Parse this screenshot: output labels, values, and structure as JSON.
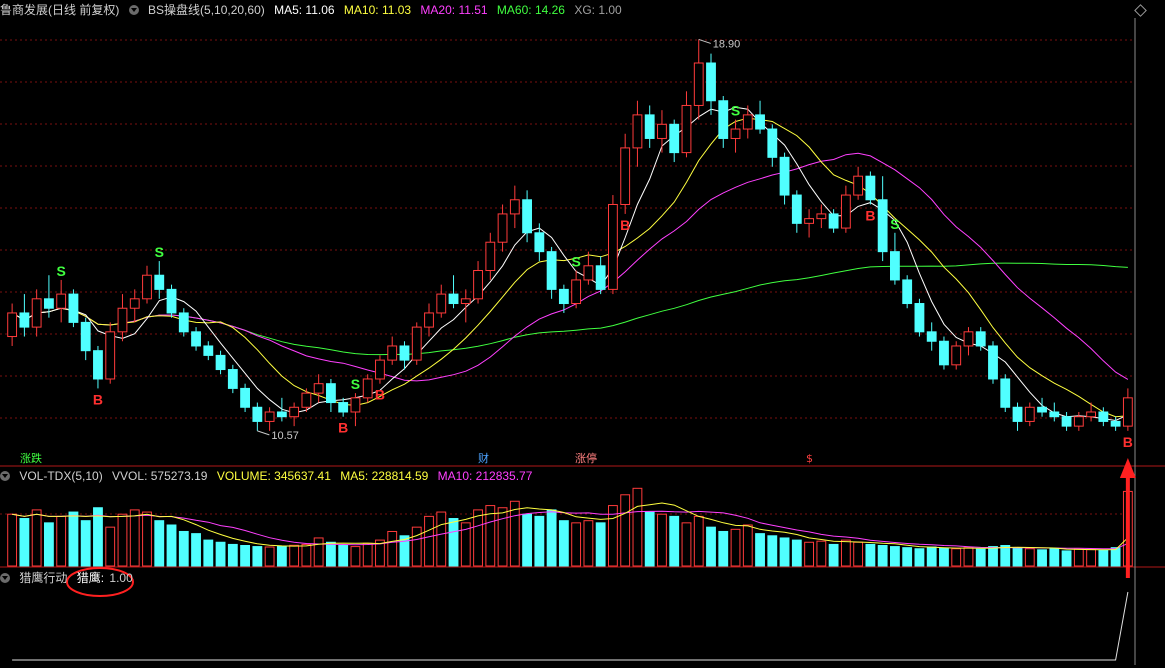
{
  "header": {
    "stock": "鲁商发展(日线 前复权)",
    "indicator": "BS操盘线(5,10,20,60)",
    "ma5": "MA5: 11.06",
    "ma10": "MA10: 11.03",
    "ma20": "MA20: 11.51",
    "ma60": "MA60: 14.26",
    "xg": "XG: 1.00"
  },
  "vol_header": {
    "name": "VOL-TDX(5,10)",
    "vvol": "VVOL: 575273.19",
    "volume": "VOLUME: 345637.41",
    "ma5": "MA5: 228814.59",
    "ma10": "MA10: 212835.77"
  },
  "bottom_header": {
    "name": "猎鹰行动",
    "value_label": "猎鹰:",
    "value": "1.00"
  },
  "annotations": {
    "high": "18.90",
    "low": "10.57",
    "event_labels": [
      "涨跌",
      "财",
      "涨停",
      "$"
    ]
  },
  "colors": {
    "up": "#ff3b3b",
    "down": "#50ffff",
    "ma5": "#ffffff",
    "ma10": "#ffff40",
    "ma20": "#ff40ff",
    "ma60": "#40ff40",
    "grid": "#7a1010",
    "separator": "#b01818",
    "signal_s": "#40ff40",
    "signal_b": "#ff3030",
    "arrow": "#ff2020"
  },
  "chart_data": [
    {
      "type": "candlestick",
      "name": "price",
      "ohlc": [
        [
          12.6,
          13.3,
          12.4,
          13.1
        ],
        [
          13.1,
          13.5,
          12.6,
          12.8
        ],
        [
          12.8,
          13.6,
          12.6,
          13.4
        ],
        [
          13.4,
          13.9,
          13.0,
          13.2
        ],
        [
          13.2,
          13.8,
          12.9,
          13.5
        ],
        [
          13.5,
          13.6,
          12.8,
          12.9
        ],
        [
          12.9,
          13.0,
          12.1,
          12.3
        ],
        [
          12.3,
          12.4,
          11.5,
          11.7
        ],
        [
          11.7,
          12.9,
          11.6,
          12.7
        ],
        [
          12.7,
          13.5,
          12.5,
          13.2
        ],
        [
          13.2,
          13.6,
          12.9,
          13.4
        ],
        [
          13.4,
          14.1,
          13.3,
          13.9
        ],
        [
          13.9,
          14.2,
          13.4,
          13.6
        ],
        [
          13.6,
          13.7,
          13.0,
          13.1
        ],
        [
          13.1,
          13.2,
          12.6,
          12.7
        ],
        [
          12.7,
          12.8,
          12.3,
          12.4
        ],
        [
          12.4,
          12.5,
          12.1,
          12.2
        ],
        [
          12.2,
          12.3,
          11.8,
          11.9
        ],
        [
          11.9,
          12.0,
          11.4,
          11.5
        ],
        [
          11.5,
          11.6,
          11.0,
          11.1
        ],
        [
          11.1,
          11.2,
          10.6,
          10.8
        ],
        [
          10.8,
          11.1,
          10.6,
          11.0
        ],
        [
          11.0,
          11.3,
          10.8,
          10.9
        ],
        [
          10.9,
          11.2,
          10.7,
          11.1
        ],
        [
          11.1,
          11.5,
          11.0,
          11.4
        ],
        [
          11.4,
          11.8,
          11.2,
          11.6
        ],
        [
          11.6,
          11.7,
          11.0,
          11.2
        ],
        [
          11.2,
          11.3,
          10.9,
          11.0
        ],
        [
          11.0,
          11.4,
          10.7,
          11.3
        ],
        [
          11.3,
          11.8,
          11.2,
          11.7
        ],
        [
          11.7,
          12.2,
          11.6,
          12.1
        ],
        [
          12.1,
          12.6,
          12.0,
          12.4
        ],
        [
          12.4,
          12.5,
          11.9,
          12.1
        ],
        [
          12.1,
          12.9,
          12.0,
          12.8
        ],
        [
          12.8,
          13.3,
          12.6,
          13.1
        ],
        [
          13.1,
          13.7,
          13.0,
          13.5
        ],
        [
          13.5,
          13.9,
          13.2,
          13.3
        ],
        [
          13.3,
          13.6,
          12.9,
          13.4
        ],
        [
          13.4,
          14.2,
          13.3,
          14.0
        ],
        [
          14.0,
          14.8,
          13.8,
          14.6
        ],
        [
          14.6,
          15.4,
          14.4,
          15.2
        ],
        [
          15.2,
          15.8,
          14.9,
          15.5
        ],
        [
          15.5,
          15.7,
          14.6,
          14.8
        ],
        [
          14.8,
          15.0,
          14.2,
          14.4
        ],
        [
          14.4,
          14.5,
          13.4,
          13.6
        ],
        [
          13.6,
          13.7,
          13.1,
          13.3
        ],
        [
          13.3,
          14.0,
          13.2,
          13.8
        ],
        [
          13.8,
          14.4,
          13.7,
          14.1
        ],
        [
          14.1,
          14.3,
          13.5,
          13.6
        ],
        [
          13.6,
          15.6,
          13.5,
          15.4
        ],
        [
          15.4,
          16.9,
          15.2,
          16.6
        ],
        [
          16.6,
          17.6,
          16.2,
          17.3
        ],
        [
          17.3,
          17.5,
          16.6,
          16.8
        ],
        [
          16.8,
          17.4,
          16.5,
          17.1
        ],
        [
          17.1,
          17.2,
          16.3,
          16.5
        ],
        [
          16.5,
          17.8,
          16.4,
          17.5
        ],
        [
          17.5,
          18.9,
          17.2,
          18.4
        ],
        [
          18.4,
          18.6,
          17.3,
          17.6
        ],
        [
          17.6,
          17.7,
          16.6,
          16.8
        ],
        [
          16.8,
          17.2,
          16.5,
          17.0
        ],
        [
          17.0,
          17.5,
          16.8,
          17.3
        ],
        [
          17.3,
          17.6,
          16.9,
          17.0
        ],
        [
          17.0,
          17.1,
          16.2,
          16.4
        ],
        [
          16.4,
          16.5,
          15.4,
          15.6
        ],
        [
          15.6,
          15.7,
          14.8,
          15.0
        ],
        [
          15.0,
          15.3,
          14.7,
          15.1
        ],
        [
          15.1,
          15.4,
          14.9,
          15.2
        ],
        [
          15.2,
          15.3,
          14.8,
          14.9
        ],
        [
          14.9,
          15.8,
          14.8,
          15.6
        ],
        [
          15.6,
          16.2,
          15.5,
          16.0
        ],
        [
          16.0,
          16.1,
          15.4,
          15.5
        ],
        [
          15.5,
          16.0,
          14.2,
          14.4
        ],
        [
          14.4,
          14.8,
          13.7,
          13.8
        ],
        [
          13.8,
          13.9,
          13.2,
          13.3
        ],
        [
          13.3,
          13.4,
          12.6,
          12.7
        ],
        [
          12.7,
          12.9,
          12.3,
          12.5
        ],
        [
          12.5,
          12.6,
          11.9,
          12.0
        ],
        [
          12.0,
          12.5,
          11.9,
          12.4
        ],
        [
          12.4,
          12.8,
          12.2,
          12.7
        ],
        [
          12.7,
          12.8,
          12.3,
          12.4
        ],
        [
          12.4,
          12.5,
          11.6,
          11.7
        ],
        [
          11.7,
          11.8,
          11.0,
          11.1
        ],
        [
          11.1,
          11.2,
          10.6,
          10.8
        ],
        [
          10.8,
          11.2,
          10.7,
          11.1
        ],
        [
          11.1,
          11.3,
          10.9,
          11.0
        ],
        [
          11.0,
          11.2,
          10.8,
          10.9
        ],
        [
          10.9,
          11.0,
          10.6,
          10.7
        ],
        [
          10.7,
          11.0,
          10.6,
          10.9
        ],
        [
          10.9,
          11.2,
          10.8,
          11.0
        ],
        [
          11.0,
          11.1,
          10.7,
          10.8
        ],
        [
          10.8,
          10.9,
          10.6,
          10.7
        ],
        [
          10.7,
          11.5,
          10.6,
          11.3
        ]
      ],
      "signals": [
        {
          "label": "S",
          "index": 4
        },
        {
          "label": "B",
          "index": 7
        },
        {
          "label": "S",
          "index": 12
        },
        {
          "label": "S",
          "index": 28
        },
        {
          "label": "B",
          "index": 27
        },
        {
          "label": "B",
          "index": 30
        },
        {
          "label": "S",
          "index": 46
        },
        {
          "label": "B",
          "index": 50
        },
        {
          "label": "S",
          "index": 59
        },
        {
          "label": "B",
          "index": 70
        },
        {
          "label": "S",
          "index": 72
        },
        {
          "label": "B",
          "index": 91
        }
      ]
    },
    {
      "type": "bar",
      "name": "VOLUME",
      "values": [
        240000,
        220000,
        260000,
        200000,
        230000,
        250000,
        210000,
        270000,
        180000,
        240000,
        260000,
        250000,
        210000,
        190000,
        160000,
        150000,
        120000,
        110000,
        100000,
        95000,
        90000,
        88000,
        92000,
        96000,
        100000,
        130000,
        110000,
        95000,
        90000,
        105000,
        120000,
        160000,
        140000,
        180000,
        230000,
        250000,
        220000,
        200000,
        260000,
        280000,
        270000,
        300000,
        240000,
        230000,
        260000,
        210000,
        200000,
        210000,
        200000,
        280000,
        330000,
        360000,
        250000,
        240000,
        230000,
        200000,
        230000,
        180000,
        160000,
        170000,
        190000,
        150000,
        140000,
        130000,
        120000,
        110000,
        115000,
        100000,
        120000,
        110000,
        100000,
        95000,
        90000,
        85000,
        80000,
        88000,
        82000,
        80000,
        85000,
        78000,
        90000,
        95000,
        85000,
        80000,
        75000,
        82000,
        70000,
        78000,
        76000,
        72000,
        85000,
        345637
      ]
    },
    {
      "type": "line",
      "name": "猎鹰",
      "note": "signal line, flat at 0 except final bar",
      "values": [
        0,
        0,
        0,
        0,
        0,
        0,
        0,
        0,
        0,
        0,
        0,
        0,
        0,
        0,
        0,
        0,
        0,
        0,
        0,
        0,
        0,
        0,
        0,
        0,
        0,
        0,
        0,
        0,
        0,
        0,
        0,
        0,
        0,
        0,
        0,
        0,
        0,
        0,
        0,
        0,
        0,
        0,
        0,
        0,
        0,
        0,
        0,
        0,
        0,
        0,
        0,
        0,
        0,
        0,
        0,
        0,
        0,
        0,
        0,
        0,
        0,
        0,
        0,
        0,
        0,
        0,
        0,
        0,
        0,
        0,
        0,
        0,
        0,
        0,
        0,
        0,
        0,
        0,
        0,
        0,
        0,
        0,
        0,
        0,
        0,
        0,
        0,
        0,
        0,
        0,
        0,
        1
      ]
    }
  ]
}
